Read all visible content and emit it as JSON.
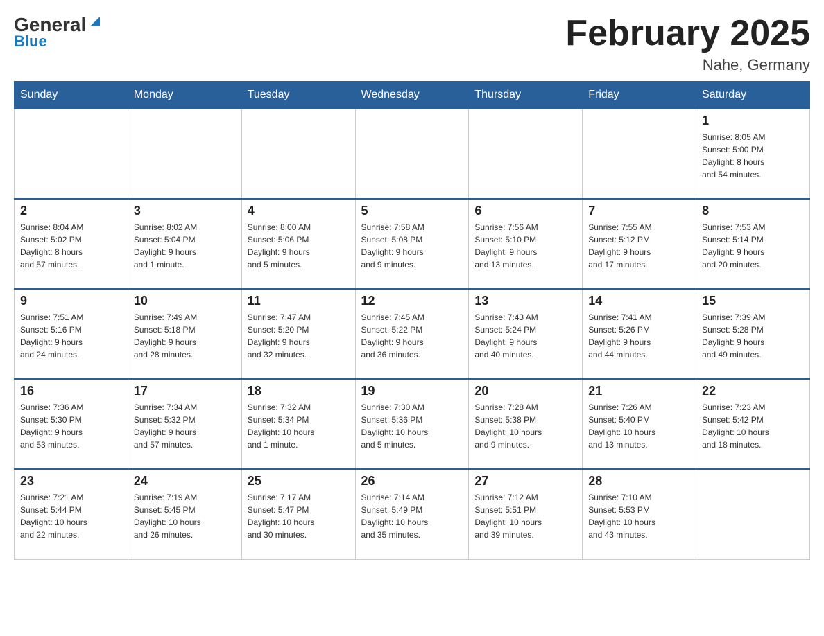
{
  "header": {
    "logo_general": "General",
    "logo_blue": "Blue",
    "month_title": "February 2025",
    "location": "Nahe, Germany"
  },
  "weekdays": [
    "Sunday",
    "Monday",
    "Tuesday",
    "Wednesday",
    "Thursday",
    "Friday",
    "Saturday"
  ],
  "weeks": [
    [
      {
        "day": "",
        "info": ""
      },
      {
        "day": "",
        "info": ""
      },
      {
        "day": "",
        "info": ""
      },
      {
        "day": "",
        "info": ""
      },
      {
        "day": "",
        "info": ""
      },
      {
        "day": "",
        "info": ""
      },
      {
        "day": "1",
        "info": "Sunrise: 8:05 AM\nSunset: 5:00 PM\nDaylight: 8 hours\nand 54 minutes."
      }
    ],
    [
      {
        "day": "2",
        "info": "Sunrise: 8:04 AM\nSunset: 5:02 PM\nDaylight: 8 hours\nand 57 minutes."
      },
      {
        "day": "3",
        "info": "Sunrise: 8:02 AM\nSunset: 5:04 PM\nDaylight: 9 hours\nand 1 minute."
      },
      {
        "day": "4",
        "info": "Sunrise: 8:00 AM\nSunset: 5:06 PM\nDaylight: 9 hours\nand 5 minutes."
      },
      {
        "day": "5",
        "info": "Sunrise: 7:58 AM\nSunset: 5:08 PM\nDaylight: 9 hours\nand 9 minutes."
      },
      {
        "day": "6",
        "info": "Sunrise: 7:56 AM\nSunset: 5:10 PM\nDaylight: 9 hours\nand 13 minutes."
      },
      {
        "day": "7",
        "info": "Sunrise: 7:55 AM\nSunset: 5:12 PM\nDaylight: 9 hours\nand 17 minutes."
      },
      {
        "day": "8",
        "info": "Sunrise: 7:53 AM\nSunset: 5:14 PM\nDaylight: 9 hours\nand 20 minutes."
      }
    ],
    [
      {
        "day": "9",
        "info": "Sunrise: 7:51 AM\nSunset: 5:16 PM\nDaylight: 9 hours\nand 24 minutes."
      },
      {
        "day": "10",
        "info": "Sunrise: 7:49 AM\nSunset: 5:18 PM\nDaylight: 9 hours\nand 28 minutes."
      },
      {
        "day": "11",
        "info": "Sunrise: 7:47 AM\nSunset: 5:20 PM\nDaylight: 9 hours\nand 32 minutes."
      },
      {
        "day": "12",
        "info": "Sunrise: 7:45 AM\nSunset: 5:22 PM\nDaylight: 9 hours\nand 36 minutes."
      },
      {
        "day": "13",
        "info": "Sunrise: 7:43 AM\nSunset: 5:24 PM\nDaylight: 9 hours\nand 40 minutes."
      },
      {
        "day": "14",
        "info": "Sunrise: 7:41 AM\nSunset: 5:26 PM\nDaylight: 9 hours\nand 44 minutes."
      },
      {
        "day": "15",
        "info": "Sunrise: 7:39 AM\nSunset: 5:28 PM\nDaylight: 9 hours\nand 49 minutes."
      }
    ],
    [
      {
        "day": "16",
        "info": "Sunrise: 7:36 AM\nSunset: 5:30 PM\nDaylight: 9 hours\nand 53 minutes."
      },
      {
        "day": "17",
        "info": "Sunrise: 7:34 AM\nSunset: 5:32 PM\nDaylight: 9 hours\nand 57 minutes."
      },
      {
        "day": "18",
        "info": "Sunrise: 7:32 AM\nSunset: 5:34 PM\nDaylight: 10 hours\nand 1 minute."
      },
      {
        "day": "19",
        "info": "Sunrise: 7:30 AM\nSunset: 5:36 PM\nDaylight: 10 hours\nand 5 minutes."
      },
      {
        "day": "20",
        "info": "Sunrise: 7:28 AM\nSunset: 5:38 PM\nDaylight: 10 hours\nand 9 minutes."
      },
      {
        "day": "21",
        "info": "Sunrise: 7:26 AM\nSunset: 5:40 PM\nDaylight: 10 hours\nand 13 minutes."
      },
      {
        "day": "22",
        "info": "Sunrise: 7:23 AM\nSunset: 5:42 PM\nDaylight: 10 hours\nand 18 minutes."
      }
    ],
    [
      {
        "day": "23",
        "info": "Sunrise: 7:21 AM\nSunset: 5:44 PM\nDaylight: 10 hours\nand 22 minutes."
      },
      {
        "day": "24",
        "info": "Sunrise: 7:19 AM\nSunset: 5:45 PM\nDaylight: 10 hours\nand 26 minutes."
      },
      {
        "day": "25",
        "info": "Sunrise: 7:17 AM\nSunset: 5:47 PM\nDaylight: 10 hours\nand 30 minutes."
      },
      {
        "day": "26",
        "info": "Sunrise: 7:14 AM\nSunset: 5:49 PM\nDaylight: 10 hours\nand 35 minutes."
      },
      {
        "day": "27",
        "info": "Sunrise: 7:12 AM\nSunset: 5:51 PM\nDaylight: 10 hours\nand 39 minutes."
      },
      {
        "day": "28",
        "info": "Sunrise: 7:10 AM\nSunset: 5:53 PM\nDaylight: 10 hours\nand 43 minutes."
      },
      {
        "day": "",
        "info": ""
      }
    ]
  ]
}
